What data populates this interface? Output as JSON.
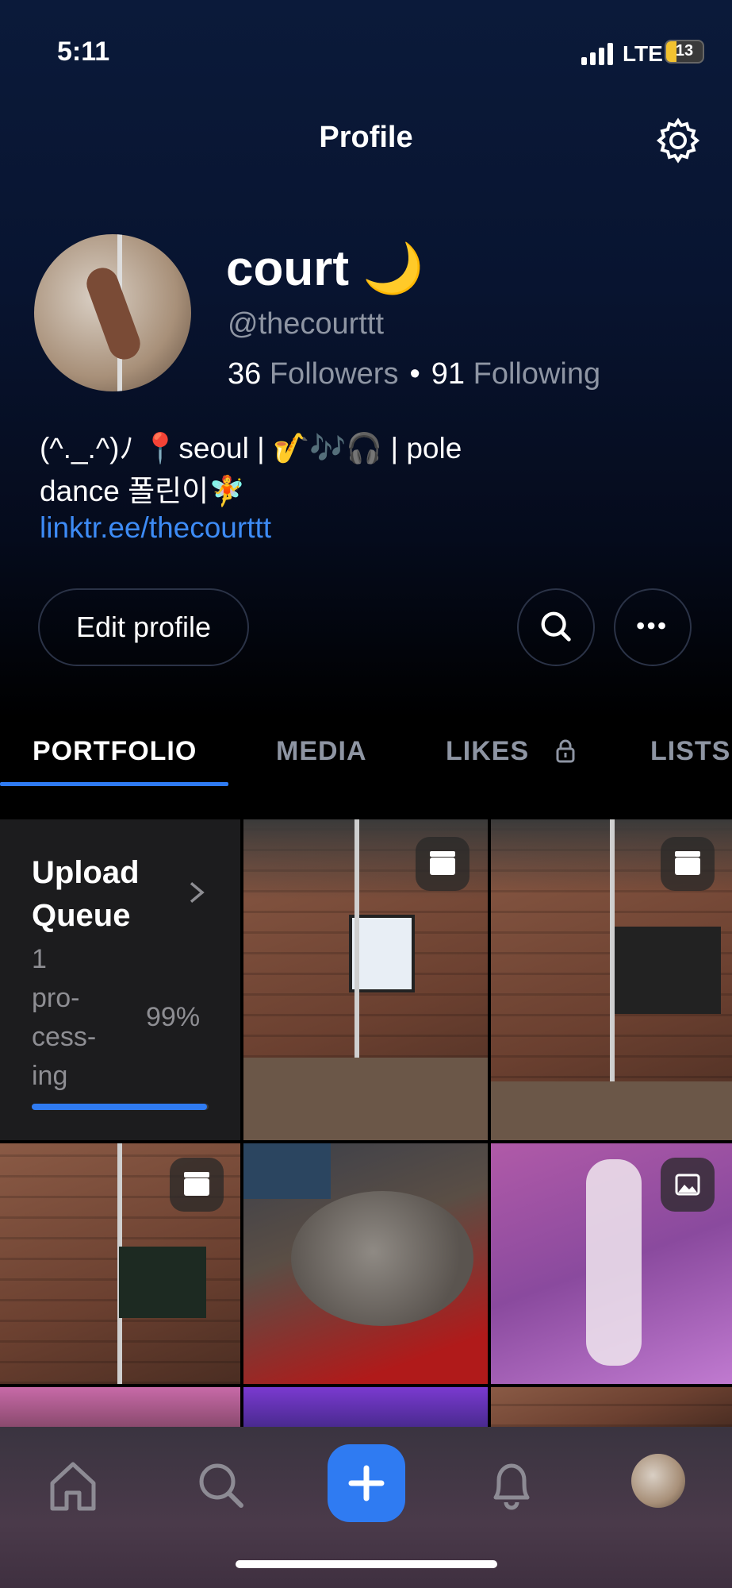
{
  "status_bar": {
    "time": "5:11",
    "network": "LTE",
    "battery": "13"
  },
  "nav": {
    "title": "Profile",
    "settings_icon": "gear-icon"
  },
  "profile": {
    "display_name": "court 🌙",
    "handle": "@thecourttt",
    "followers_count": "36",
    "followers_label": "Followers",
    "following_count": "91",
    "following_label": "Following",
    "bio_line1": "(^._.^)ﾉ 📍seoul | 🎷🎶🎧 | pole",
    "bio_line2": "dance 폴린이🧚",
    "link": "linktr.ee/thecourttt"
  },
  "actions": {
    "edit_profile": "Edit profile"
  },
  "tabs": [
    {
      "label": "PORTFOLIO",
      "active": true
    },
    {
      "label": "MEDIA",
      "active": false
    },
    {
      "label": "LIKES",
      "active": false,
      "locked": true
    },
    {
      "label": "LISTS",
      "active": false
    }
  ],
  "upload_queue": {
    "title_line1": "Upload",
    "title_line2": "Queue",
    "status_lines": [
      "1",
      "pro-",
      "cess-",
      "ing"
    ],
    "percent": "99%",
    "progress_fraction": 0.99
  },
  "grid_items": [
    {
      "type": "video-icon",
      "desc": "pole dance studio"
    },
    {
      "type": "video-icon",
      "desc": "pole dance studio"
    },
    {
      "type": "video-icon",
      "desc": "pole dance studio"
    },
    {
      "type": "none",
      "desc": "cat"
    },
    {
      "type": "gallery-icon",
      "desc": "pole dance studio"
    }
  ],
  "tab_bar": {
    "items": [
      "home-icon",
      "search-icon",
      "plus-icon",
      "bell-icon",
      "avatar"
    ]
  },
  "colors": {
    "accent": "#2f7bf2",
    "link": "#3d8bf5",
    "muted": "#8e95a3"
  }
}
